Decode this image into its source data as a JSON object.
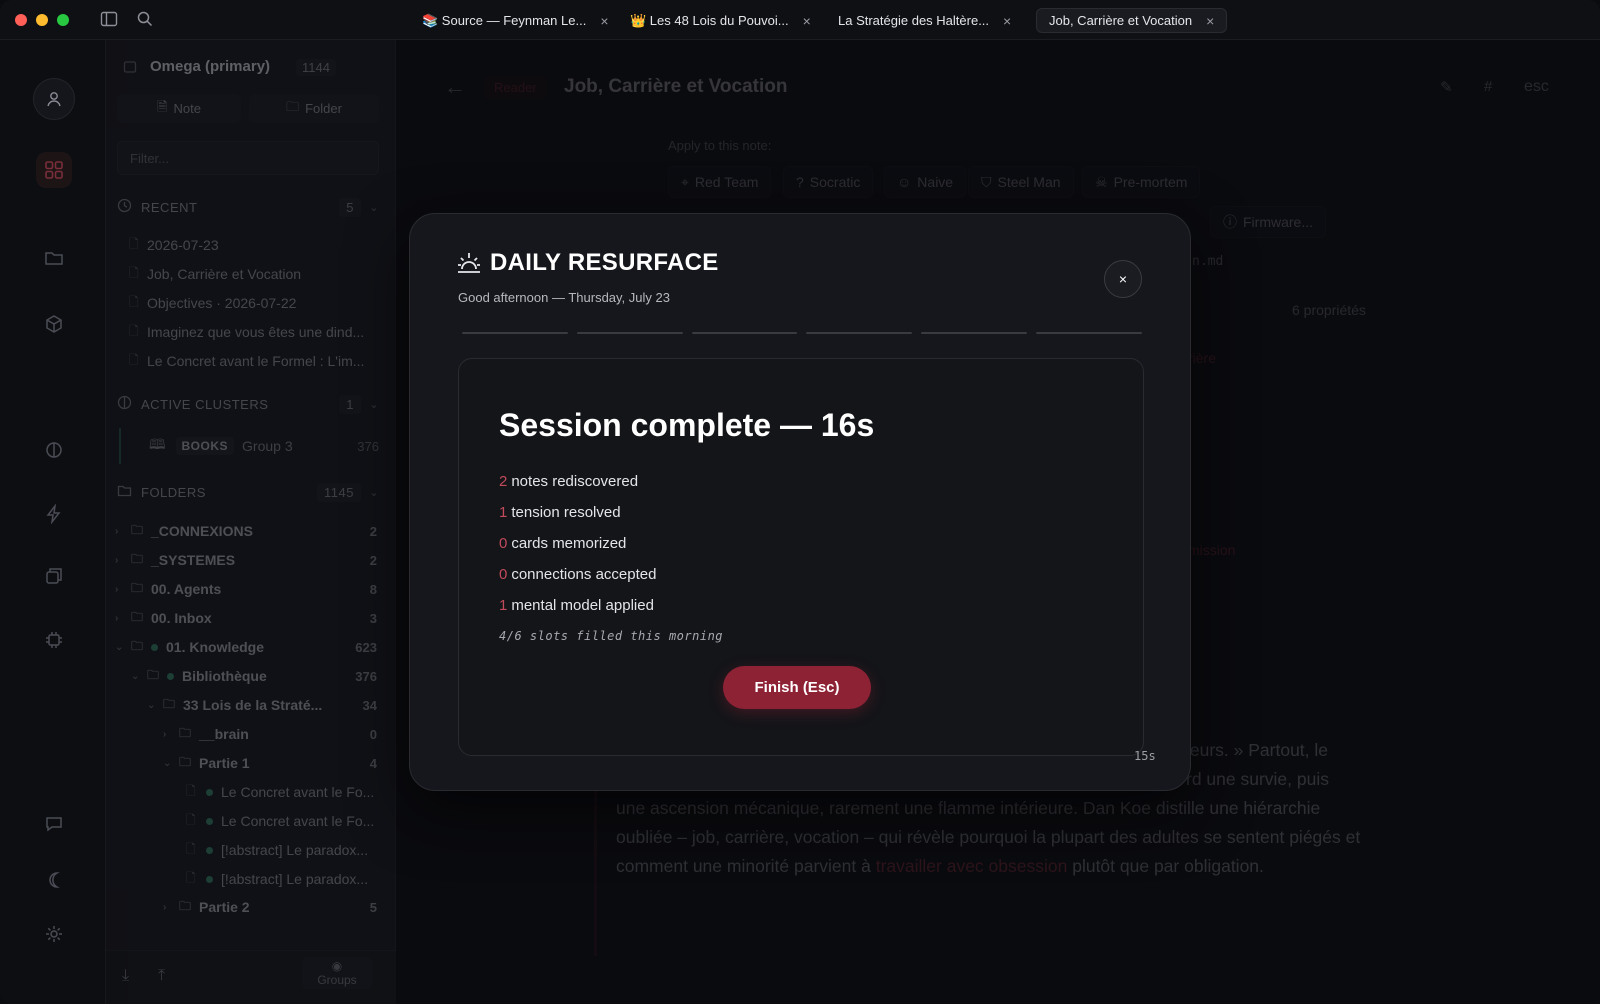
{
  "tabs": [
    {
      "label": "📚 Source — Feynman Le...",
      "active": false
    },
    {
      "label": "👑 Les 48 Lois du Pouvoi...",
      "active": false
    },
    {
      "label": "La Stratégie des Haltère...",
      "active": false
    },
    {
      "label": "Job, Carrière et Vocation",
      "active": true
    }
  ],
  "tab_close": "×",
  "sidebar": {
    "vault_title": "Omega (primary)",
    "vault_count": "1144",
    "note_button": "Note",
    "folder_button": "Folder",
    "filter_placeholder": "Filter...",
    "recent": {
      "label": "RECENT",
      "count": "5",
      "items": [
        "2026-07-23",
        "Job, Carrière et Vocation",
        "Objectives · 2026-07-22",
        "Imaginez que vous êtes une dind...",
        "Le Concret avant le Formel : L'im..."
      ]
    },
    "clusters": {
      "label": "ACTIVE CLUSTERS",
      "count": "1",
      "tag": "BOOKS",
      "group": "Group 3",
      "group_count": "376"
    },
    "folders": {
      "label": "FOLDERS",
      "count": "1145",
      "rows": [
        {
          "label": "_CONNEXIONS",
          "count": "2"
        },
        {
          "label": "_SYSTEMES",
          "count": "2"
        },
        {
          "label": "00. Agents",
          "count": "8"
        },
        {
          "label": "00. Inbox",
          "count": "3"
        },
        {
          "label": "01. Knowledge",
          "count": "623"
        },
        {
          "label": "Bibliothèque",
          "count": "376"
        },
        {
          "label": "33 Lois de la Straté...",
          "count": "34"
        },
        {
          "label": "__brain",
          "count": "0"
        },
        {
          "label": "Partie 1",
          "count": "4"
        },
        {
          "label": "Le Concret avant le Fo...",
          "count": ""
        },
        {
          "label": "Le Concret avant le Fo...",
          "count": ""
        },
        {
          "label": "[!abstract] Le paradox...",
          "count": ""
        },
        {
          "label": "[!abstract] Le paradox...",
          "count": ""
        },
        {
          "label": "Partie 2",
          "count": "5"
        }
      ]
    },
    "groups_button": "Groups"
  },
  "main": {
    "mode_badge": "Reader",
    "note_title": "Job, Carrière et Vocation",
    "esc_label": "esc",
    "apply_label": "Apply to this note:",
    "lenses": [
      "Red Team",
      "Socratic",
      "Naive",
      "Steel Man",
      "Pre-mortem"
    ],
    "firmware": "Firmware...",
    "file_suffix": "n.md",
    "properties": "6 propriétés",
    "ghost_red_1": "rière",
    "ghost_red_2": "mission",
    "body_a": "leurs. » Partout, le",
    "body_b": "rd une survie, puis",
    "body_c": "une ascension mécanique, rarement une flamme intérieure. Dan Koe distille une hiérarchie oubliée – job, carrière, vocation – qui révèle pourquoi la plupart des adultes se sentent piégés et comment une minorité parvient à",
    "body_link": "travailler avec obsession",
    "body_d": "plutôt que par obligation."
  },
  "modal": {
    "title": "DAILY RESURFACE",
    "subtitle": "Good afternoon — Thursday, July 23",
    "close": "×",
    "progress_total": 6,
    "session_title": "Session complete — 16s",
    "stats": [
      {
        "num": "2",
        "label": "notes rediscovered"
      },
      {
        "num": "1",
        "label": "tension resolved"
      },
      {
        "num": "0",
        "label": "cards memorized"
      },
      {
        "num": "0",
        "label": "connections accepted"
      },
      {
        "num": "1",
        "label": "mental model applied"
      }
    ],
    "slots": "4/6 slots filled this morning",
    "finish_label": "Finish (Esc)",
    "timer": "15s"
  },
  "colors": {
    "accent": "#8e2235",
    "stat_number": "#c14a5b"
  }
}
